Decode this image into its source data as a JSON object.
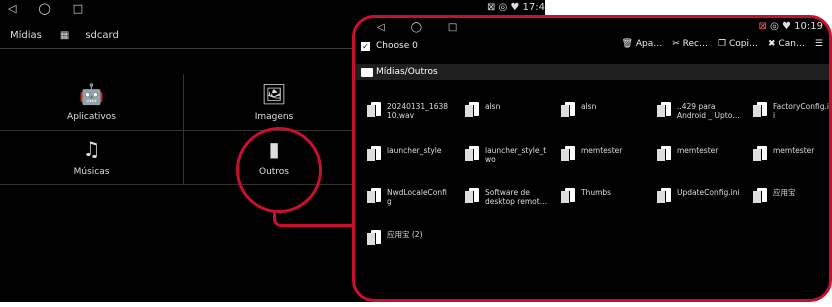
{
  "background_screen": {
    "status": {
      "left_icons": [
        "◁",
        "◯",
        "□"
      ],
      "right": "⊠ ◎ ♥ 17:4"
    },
    "appbar": {
      "title": "Mídias",
      "location": "sdcard"
    },
    "categories": [
      {
        "label": "Aplicativos",
        "icon": "android-icon"
      },
      {
        "label": "Imagens",
        "icon": "image-icon"
      },
      {
        "label": "Músicas",
        "icon": "music-icon"
      },
      {
        "label": "Outros",
        "icon": "file-icon"
      }
    ]
  },
  "foreground_screen": {
    "status": {
      "left_icons": [
        "◁",
        "◯",
        "□"
      ],
      "right_time": "10:19"
    },
    "actionbar": {
      "choose": "Choose 0",
      "actions": [
        {
          "label": "Apa…",
          "icon": "trash-icon"
        },
        {
          "label": "Rec…",
          "icon": "scissors-icon"
        },
        {
          "label": "Copi…",
          "icon": "copy-icon"
        },
        {
          "label": "Can…",
          "icon": "close-icon"
        }
      ]
    },
    "path": "Mídias/Outros",
    "files": [
      [
        "20240131_1638\n10.wav",
        "alsn",
        "alsn",
        "..429 para\nAndroid _ Upto…",
        "FactoryConfig.in\ni"
      ],
      [
        "launcher_style",
        "launcher_style_t\nwo",
        "memtester",
        "memtester",
        "memtester"
      ],
      [
        "NwdLocaleConfi\ng",
        "Software de\ndesktop remot…",
        "Thumbs",
        "UpdateConfig.ini",
        "应用宝"
      ],
      [
        "应用宝 (2)"
      ]
    ]
  }
}
